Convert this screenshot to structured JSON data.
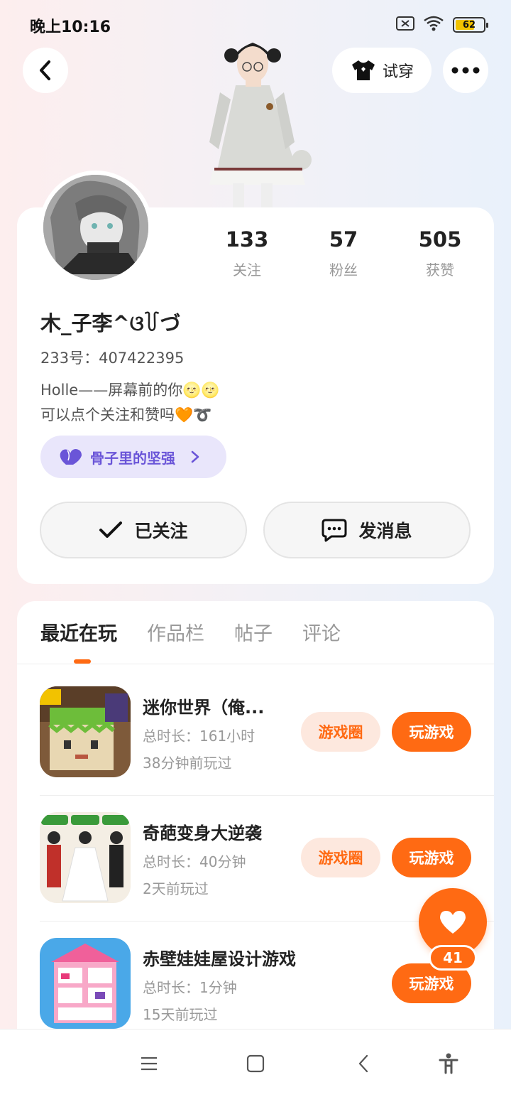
{
  "status_bar": {
    "time": "晚上10:16",
    "battery": "62"
  },
  "header": {
    "tryon_label": "试穿"
  },
  "stats": [
    {
      "value": "133",
      "label": "关注"
    },
    {
      "value": "57",
      "label": "粉丝"
    },
    {
      "value": "505",
      "label": "获赞"
    }
  ],
  "profile": {
    "username": "木_子李^ଓ꒦づ",
    "uid": "233号：407422395",
    "bio_line1": "Holle——屏幕前的你🌝🌝",
    "bio_line2": "可以点个关注和赞吗🧡➰",
    "badge": "骨子里的坚强"
  },
  "actions": {
    "follow_label": "已关注",
    "message_label": "发消息"
  },
  "tabs": [
    "最近在玩",
    "作品栏",
    "帖子",
    "评论"
  ],
  "games": [
    {
      "title": "迷你世界（俺...",
      "duration": "总时长：161小时",
      "last_played": "38分钟前玩过",
      "circle_label": "游戏圈",
      "play_label": "玩游戏"
    },
    {
      "title": "奇葩变身大逆袭",
      "duration": "总时长：40分钟",
      "last_played": "2天前玩过",
      "circle_label": "游戏圈",
      "play_label": "玩游戏"
    },
    {
      "title": "赤壁娃娃屋设计游戏",
      "duration": "总时长：1分钟",
      "last_played": "15天前玩过",
      "play_label": "玩游戏"
    }
  ],
  "like_count": "41",
  "colors": {
    "accent": "#ff6a13",
    "badge_bg": "#e9e6fb",
    "badge_text": "#6a55d8"
  }
}
